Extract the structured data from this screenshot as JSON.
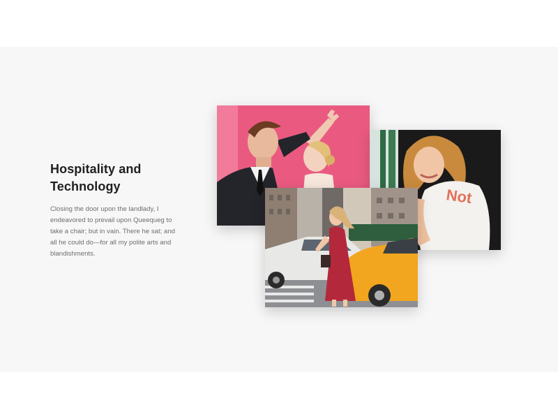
{
  "feature": {
    "title": "Hospitality and Technology",
    "description": "Closing the door upon the landlady, I endeavored to prevail upon Queequeg to take a chair; but in vain. There he sat; and all he could do—for all my polite arts and blandishments.",
    "photos": [
      {
        "name": "photo-couple-pink-wall",
        "shirt_text": ""
      },
      {
        "name": "photo-woman-white-tee",
        "shirt_text": "Not"
      },
      {
        "name": "photo-woman-street-taxi",
        "shirt_text": ""
      }
    ]
  },
  "colors": {
    "section_bg": "#f7f7f7",
    "heading": "#1f1f1f",
    "body": "#6d6d6d",
    "pink": "#ea5a80",
    "taxi": "#f2a51f",
    "dress": "#b3283a"
  }
}
